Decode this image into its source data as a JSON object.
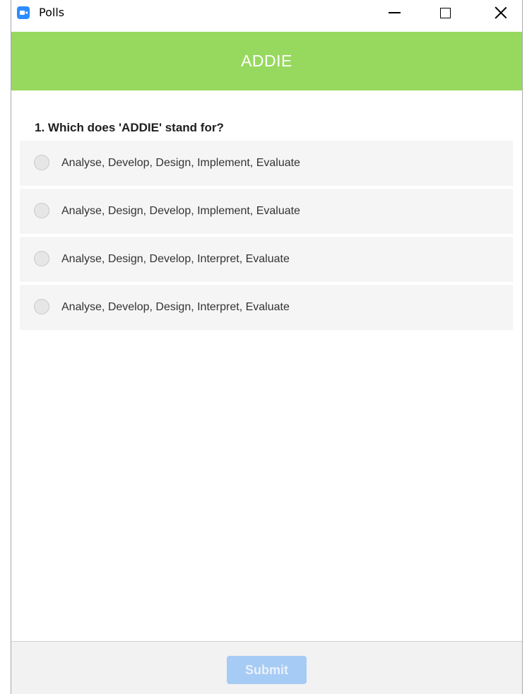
{
  "window": {
    "title": "Polls",
    "icon": "zoom-camera-icon"
  },
  "header": {
    "title": "ADDIE",
    "color": "#97d95e"
  },
  "question": {
    "text": "1. Which does 'ADDIE' stand for?",
    "options": [
      "Analyse, Develop, Design, Implement, Evaluate",
      "Analyse, Design, Develop, Implement, Evaluate",
      "Analyse, Design, Develop, Interpret, Evaluate",
      "Analyse, Develop, Design, Interpret, Evaluate"
    ]
  },
  "footer": {
    "submit_label": "Submit",
    "submit_color": "#a6cbf5"
  }
}
